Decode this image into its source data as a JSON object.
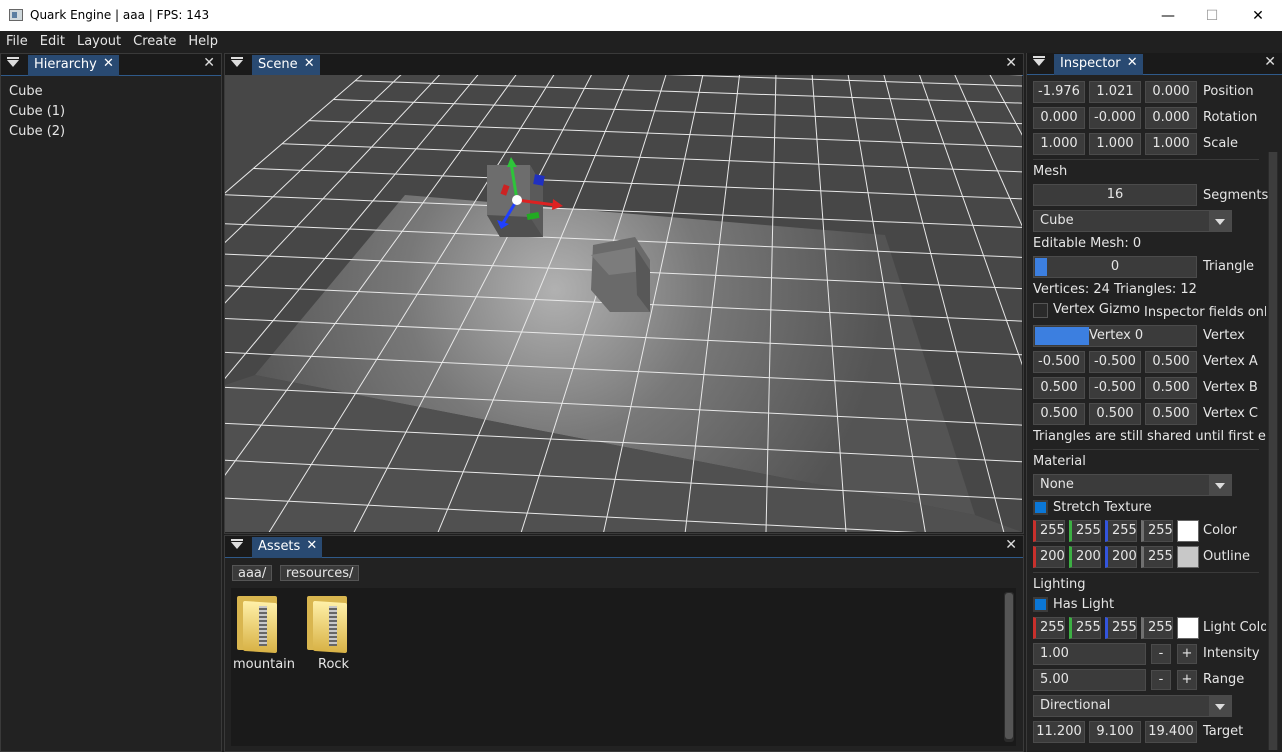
{
  "window": {
    "title": "Quark Engine | aaa | FPS: 143",
    "min": "—",
    "max": "☐",
    "close": "✕"
  },
  "menu": [
    "File",
    "Edit",
    "Layout",
    "Create",
    "Help"
  ],
  "hierarchy": {
    "tab": "Hierarchy",
    "items": [
      "Cube",
      "Cube (1)",
      "Cube (2)"
    ]
  },
  "scene": {
    "tab": "Scene"
  },
  "assets": {
    "tab": "Assets",
    "crumbs": [
      "aaa/",
      "resources/"
    ],
    "folders": [
      "mountain",
      "Rock"
    ]
  },
  "inspector": {
    "tab": "Inspector",
    "position": {
      "values": [
        "-1.976",
        "1.021",
        "0.000"
      ],
      "label": "Position"
    },
    "rotation": {
      "values": [
        "0.000",
        "-0.000",
        "0.000"
      ],
      "label": "Rotation"
    },
    "scale": {
      "values": [
        "1.000",
        "1.000",
        "1.000"
      ],
      "label": "Scale"
    },
    "mesh_header": "Mesh",
    "segments": {
      "value": "16",
      "label": "Segments"
    },
    "mesh_type": "Cube",
    "editable_mesh": "Editable Mesh: 0",
    "triangle": {
      "value": "0",
      "label": "Triangle"
    },
    "counts": "Vertices: 24  Triangles: 12",
    "vertex_gizmo": "Vertex Gizmo",
    "inspector_fields_note": "Inspector fields only",
    "vertex": {
      "value": "Vertex 0",
      "label": "Vertex"
    },
    "vertex_a": {
      "values": [
        "-0.500",
        "-0.500",
        "0.500"
      ],
      "label": "Vertex A"
    },
    "vertex_b": {
      "values": [
        "0.500",
        "-0.500",
        "0.500"
      ],
      "label": "Vertex B"
    },
    "vertex_c": {
      "values": [
        "0.500",
        "0.500",
        "0.500"
      ],
      "label": "Vertex C"
    },
    "shared_note": "Triangles are still shared until first edit",
    "material_header": "Material",
    "material": "None",
    "stretch_texture": "Stretch Texture",
    "color": {
      "values": [
        "255",
        "255",
        "255",
        "255"
      ],
      "label": "Color",
      "swatch": "#ffffff"
    },
    "outline": {
      "values": [
        "200",
        "200",
        "200",
        "255"
      ],
      "label": "Outline",
      "swatch": "#c8c8c8"
    },
    "lighting_header": "Lighting",
    "has_light": "Has Light",
    "light_color": {
      "values": [
        "255",
        "255",
        "255",
        "255"
      ],
      "label": "Light Color",
      "swatch": "#ffffff"
    },
    "intensity": {
      "value": "1.00",
      "label": "Intensity"
    },
    "range": {
      "value": "5.00",
      "label": "Range"
    },
    "minus": "-",
    "plus": "+",
    "light_type": "Directional",
    "target": {
      "values": [
        "11.200",
        "9.100",
        "19.400"
      ],
      "label": "Target"
    }
  },
  "colors": {
    "accent": "#294a72",
    "check": "#0b77d6",
    "red": "#c8302c",
    "green": "#3cb043",
    "blue": "#3355dd",
    "gray": "#707070"
  }
}
